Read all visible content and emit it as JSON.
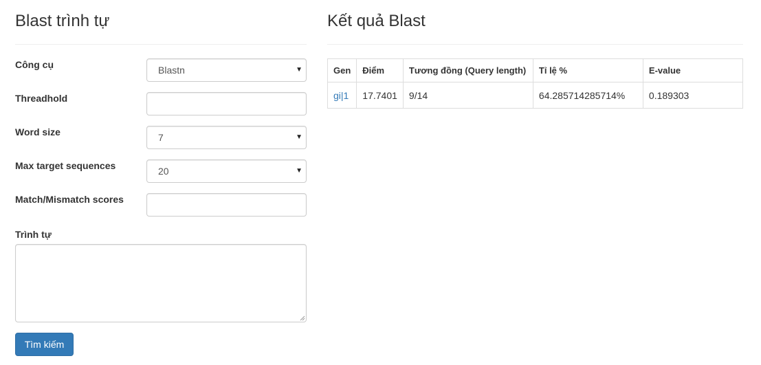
{
  "left_panel": {
    "title": "Blast trình tự",
    "fields": [
      {
        "label": "Công cụ",
        "type": "select",
        "value": "Blastn"
      },
      {
        "label": "Threadhold",
        "type": "input",
        "value": ""
      },
      {
        "label": "Word size",
        "type": "select",
        "value": "7"
      },
      {
        "label": "Max target sequences",
        "type": "select",
        "value": "20"
      },
      {
        "label": "Match/Mismatch scores",
        "type": "input",
        "value": ""
      }
    ],
    "sequence_label": "Trình tự",
    "sequence_value": "",
    "submit_label": "Tìm kiếm"
  },
  "right_panel": {
    "title": "Kết quả Blast",
    "table": {
      "headers": [
        "Gen",
        "Điểm",
        "Tương đồng (Query length)",
        "Tỉ lệ %",
        "E-value"
      ],
      "rows": [
        [
          "gi|1",
          "17.7401",
          "9/14",
          "64.285714285714%",
          "0.189303"
        ]
      ]
    }
  },
  "colors": {
    "primary": "#337ab7",
    "link": "#337ab7",
    "border": "#dddddd"
  }
}
